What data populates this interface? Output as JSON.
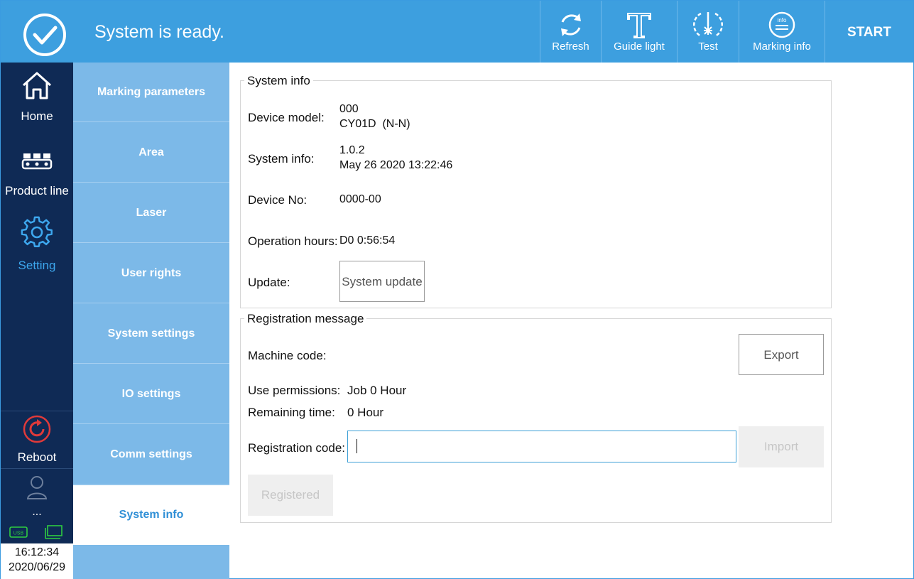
{
  "topbar": {
    "status_text": "System is ready.",
    "tools": [
      {
        "label": "Refresh",
        "icon": "refresh-icon"
      },
      {
        "label": "Guide light",
        "icon": "text-t-icon"
      },
      {
        "label": "Test",
        "icon": "laser-target-icon"
      },
      {
        "label": "Marking info",
        "icon": "info-list-icon"
      }
    ],
    "start_label": "START"
  },
  "leftnav": {
    "home": "Home",
    "product_line": "Product line",
    "setting": "Setting",
    "reboot": "Reboot",
    "user": "...",
    "time": "16:12:34",
    "date": "2020/06/29",
    "usb_label": "USB"
  },
  "submenu": {
    "items": [
      "Marking parameters",
      "Area",
      "Laser",
      "User rights",
      "System settings",
      "IO settings",
      "Comm settings",
      "System info"
    ],
    "active": "System info"
  },
  "system_info": {
    "title": "System info",
    "device_model_label": "Device model:",
    "device_model_line1": "000",
    "device_model_line2": "CY01D  (N-N)",
    "system_info_label": "System info:",
    "version": "1.0.2",
    "build_date": "May 26 2020 13:22:46",
    "device_no_label": "Device No:",
    "device_no": "0000-00",
    "operation_hours_label": "Operation hours:",
    "operation_hours": "D0 0:56:54",
    "update_label": "Update:",
    "update_button": "System update"
  },
  "registration": {
    "title": "Registration message",
    "machine_code_label": "Machine code:",
    "export_button": "Export",
    "use_permissions_label": "Use permissions:",
    "use_permissions": "Job 0 Hour",
    "remaining_time_label": "Remaining time:",
    "remaining_time": "0 Hour",
    "registration_code_label": "Registration code:",
    "registration_code_value": "",
    "import_button": "Import",
    "registered_button": "Registered"
  },
  "colors": {
    "topbar": "#3d9fdf",
    "leftnav": "#0f2a55",
    "submenu": "#7cb9e8",
    "accent": "#2f8fd6",
    "reboot": "#e03a3a",
    "status_ok": "#2ecc40"
  }
}
